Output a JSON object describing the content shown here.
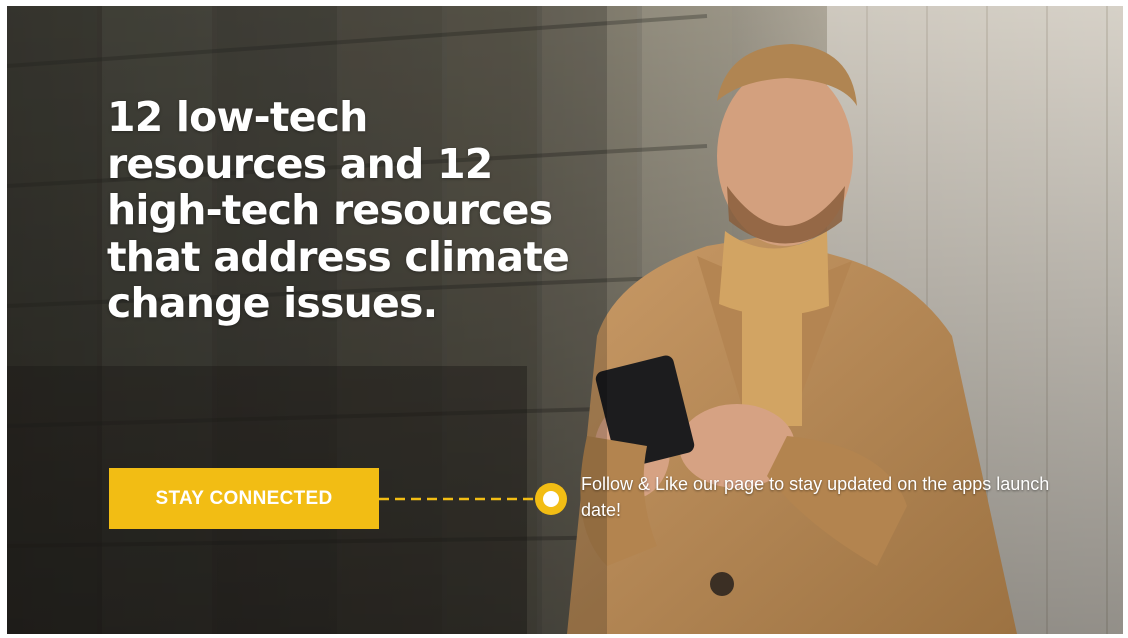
{
  "banner": {
    "headline": "12 low-tech resources and 12 high-tech resources that address climate change issues.",
    "cta_label": "STAY CONNECTED",
    "follow_text": "Follow & Like our page to stay updated on the apps launch date!"
  },
  "colors": {
    "accent": "#f2bd14",
    "text": "#ffffff"
  },
  "icons": {
    "connector": "dot-circle-icon"
  }
}
